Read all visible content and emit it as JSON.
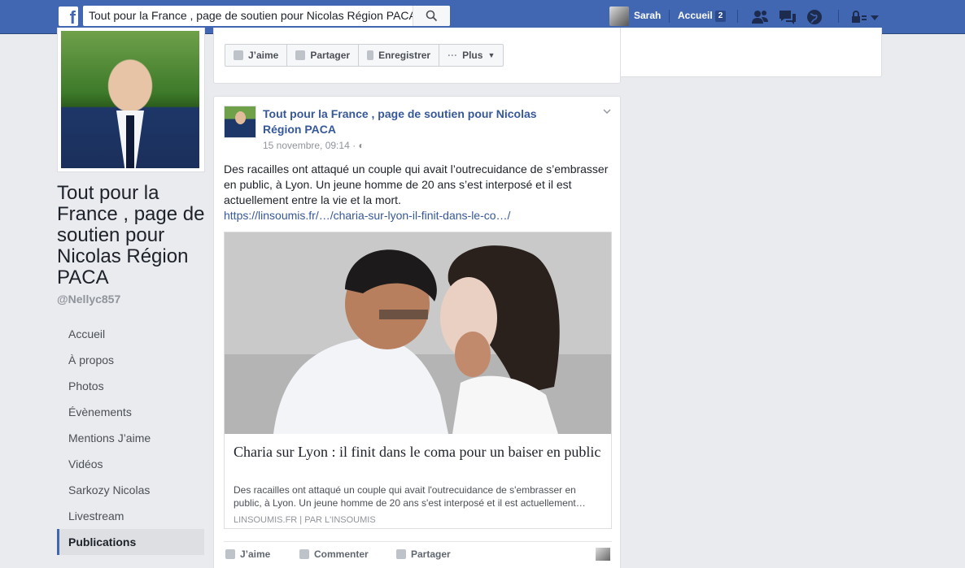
{
  "topbar": {
    "logo": "f",
    "search_value": "Tout pour la France , page de soutien pour Nicolas Région PACA",
    "user_name": "Sarah",
    "home_label": "Accueil",
    "home_count": "2"
  },
  "sidebar": {
    "page_name": "Tout pour la France , page de soutien pour Nicolas Région PACA",
    "handle": "@Nellyc857",
    "items": [
      {
        "label": "Accueil"
      },
      {
        "label": "À propos"
      },
      {
        "label": "Photos"
      },
      {
        "label": "Évènements"
      },
      {
        "label": "Mentions J’aime"
      },
      {
        "label": "Vidéos"
      },
      {
        "label": "Sarkozy Nicolas"
      },
      {
        "label": "Livestream"
      },
      {
        "label": "Publications"
      }
    ]
  },
  "top_card": {
    "like": "J’aime",
    "share": "Partager",
    "save": "Enregistrer",
    "more": "Plus"
  },
  "post": {
    "author": "Tout pour la France , page de soutien pour Nicolas Région PACA",
    "time": "15 novembre, 09:14 ·",
    "text": "Des racailles ont attaqué un couple qui avait l’outrecuidance de s’embrasser en public, à Lyon. Un jeune homme de 20 ans s’est interposé et il est actuellement entre la vie et la mort.",
    "link": "https://linsoumis.fr/…/charia-sur-lyon-il-finit-dans-le-co…/",
    "attachment": {
      "title": "Charia sur Lyon : il finit dans le coma pour un baiser en public",
      "description": "Des racailles ont attaqué un couple qui avait l'outrecuidance de s'embrasser en public, à Lyon. Un jeune homme de 20 ans s'est interposé et il est actuellement…",
      "source": "LINSOUMIS.FR  |  PAR L'INSOUMIS"
    },
    "actions": {
      "like": "J’aime",
      "comment": "Commenter",
      "share": "Partager"
    }
  },
  "colors": {
    "brand": "#4267b2",
    "link": "#365899",
    "background": "#e9ebee"
  }
}
